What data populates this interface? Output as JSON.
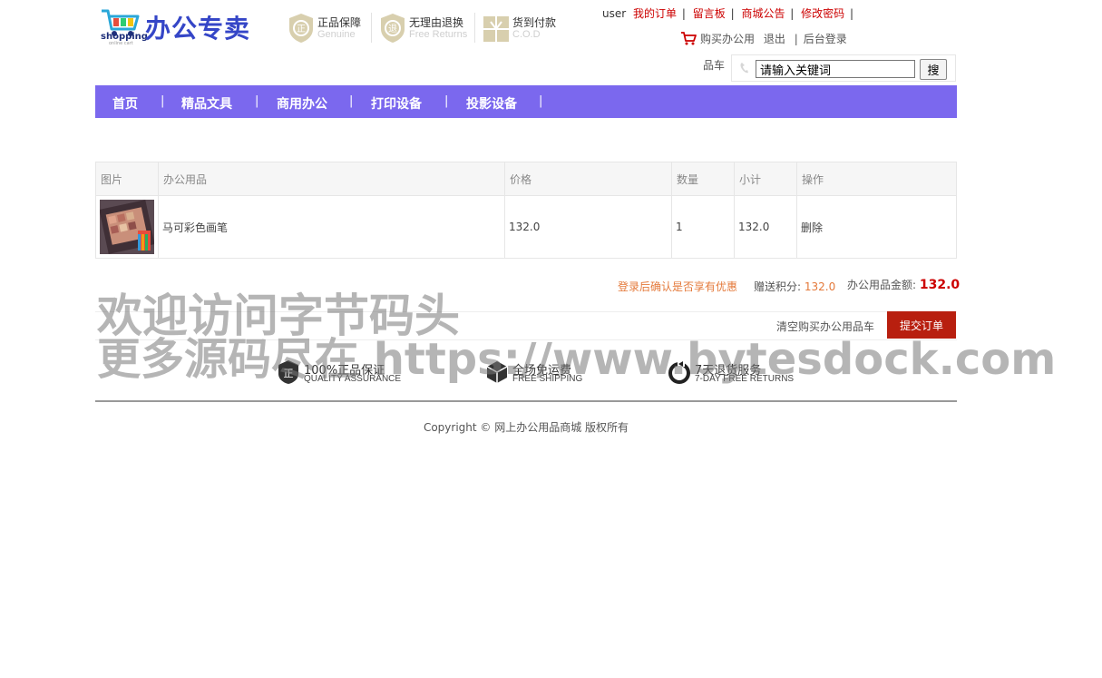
{
  "header": {
    "logo_text": "shopping",
    "logo_subtext": "online cart",
    "site_title": "办公专卖",
    "guarantees": [
      {
        "icon": "genuine-badge-icon",
        "title": "正品保障",
        "subtitle": "Genuine"
      },
      {
        "icon": "free-returns-badge-icon",
        "title": "无理由退换",
        "subtitle": "Free Returns"
      },
      {
        "icon": "cod-badge-icon",
        "title": "货到付款",
        "subtitle": "C.O.D"
      }
    ],
    "user_name": "user",
    "top_links": [
      "我的订单",
      "留言板",
      "商城公告",
      "修改密码"
    ],
    "link_separator": "|",
    "cart_link": "购买办公用",
    "logout": "退出",
    "admin_login": "后台登录",
    "cart_label_tail": "品车",
    "search": {
      "placeholder": "请输入关键词",
      "button": "搜"
    }
  },
  "nav": {
    "items": [
      "首页",
      "精品文具",
      "商用办公",
      "打印设备",
      "投影设备"
    ],
    "separator": "|"
  },
  "cart_table": {
    "headers": [
      "图片",
      "办公用品",
      "价格",
      "数量",
      "小计",
      "操作"
    ],
    "rows": [
      {
        "image": "product-thumbnail",
        "name": "马可彩色画笔",
        "price": "132.0",
        "quantity": "1",
        "subtotal": "132.0",
        "action": "删除"
      }
    ]
  },
  "summary": {
    "login_hint": "登录后确认是否享有优惠",
    "points_label": "赠送积分:",
    "points_value": "132.0",
    "total_label": "办公用品金额:",
    "total_value": "132.0"
  },
  "actions": {
    "clear_cart": "清空购买办公用品车",
    "submit": "提交订单"
  },
  "services": [
    {
      "icon": "quality-icon",
      "title": "100%正品保证",
      "subtitle": "QUALITY ASSURANCE"
    },
    {
      "icon": "shipping-icon",
      "title": "全场免运费",
      "subtitle": "FREE SHIPPING"
    },
    {
      "icon": "returns-icon",
      "title": "7天退货服务",
      "subtitle": "7-DAY FREE RETURNS"
    }
  ],
  "footer": {
    "copyright": "Copyright © 网上办公用品商城 版权所有"
  },
  "watermark": {
    "line1": "欢迎访问字节码头",
    "line2": "更多源码尽在 https://www.bytesdock.com"
  },
  "colors": {
    "nav_bg": "#7b68ee",
    "link_red": "#cc0000",
    "submit_bg": "#b81f0f",
    "logo_blue": "#3546c7",
    "hint_orange": "#e4793a"
  }
}
